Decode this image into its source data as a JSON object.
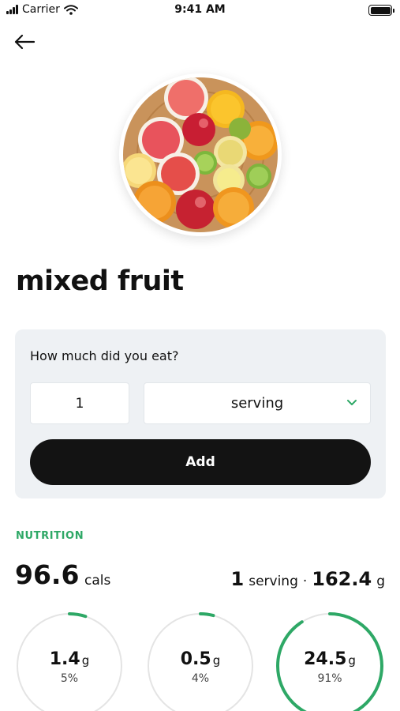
{
  "status_bar": {
    "carrier": "Carrier",
    "time": "9:41 AM"
  },
  "food": {
    "name": "mixed fruit",
    "photo_icon": "mixed-fruit-photo"
  },
  "portion": {
    "question": "How much did you eat?",
    "quantity": "1",
    "unit": "serving",
    "add_label": "Add"
  },
  "nutrition": {
    "section_label": "NUTRITION",
    "calories": "96.6",
    "calories_unit": "cals",
    "serving_qty": "1",
    "serving_unit": "serving",
    "separator": "·",
    "weight": "162.4",
    "weight_unit": "g",
    "macros": [
      {
        "amount": "1.4",
        "unit": "g",
        "percent": "5%",
        "fraction": 0.05
      },
      {
        "amount": "0.5",
        "unit": "g",
        "percent": "4%",
        "fraction": 0.04
      },
      {
        "amount": "24.5",
        "unit": "g",
        "percent": "91%",
        "fraction": 0.91
      }
    ]
  },
  "colors": {
    "accent": "#2ea866",
    "button": "#131313",
    "card": "#eef1f4",
    "ring_track": "#e4e4e4"
  }
}
